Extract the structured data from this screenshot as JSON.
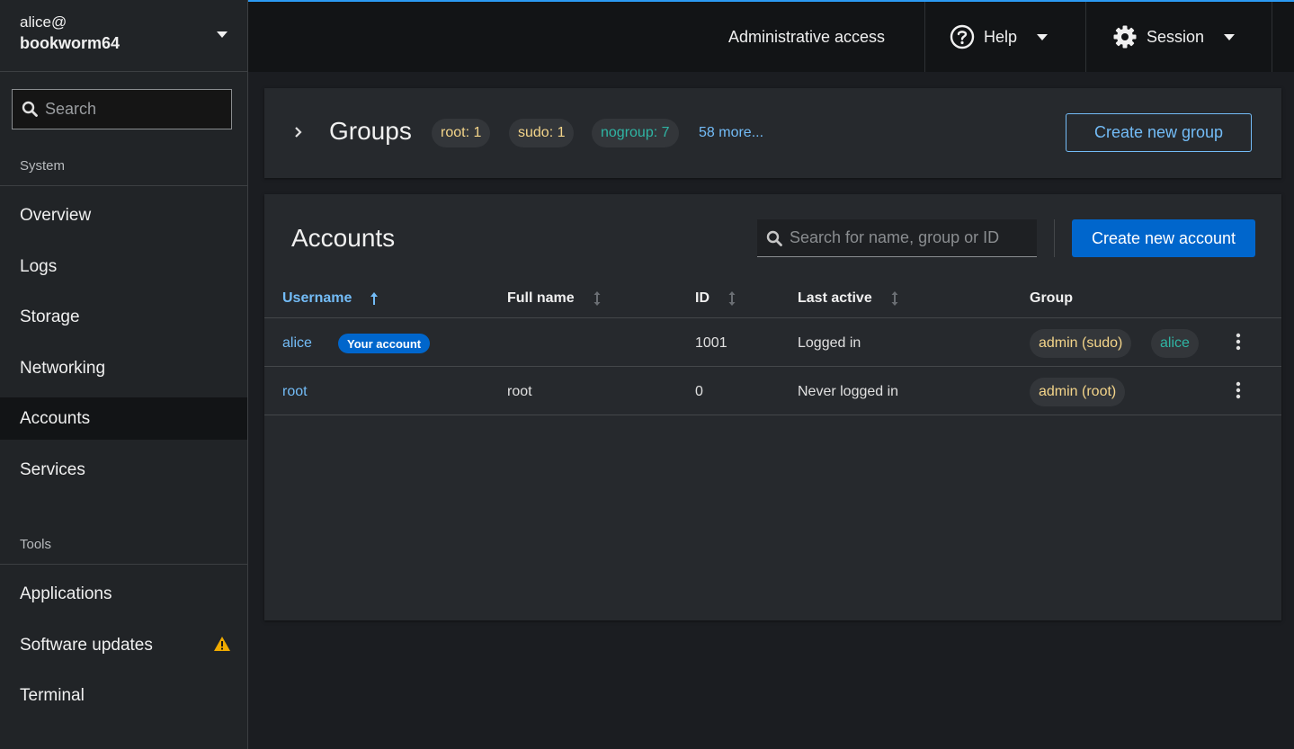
{
  "sidebar": {
    "user": "alice@",
    "host": "bookworm64",
    "search_placeholder": "Search",
    "section_system": "System",
    "system_items": [
      "Overview",
      "Logs",
      "Storage",
      "Networking",
      "Accounts",
      "Services"
    ],
    "active_item": "Accounts",
    "section_tools": "Tools",
    "tools_items": [
      "Applications",
      "Software updates",
      "Terminal"
    ],
    "warning_color": "#f0ab00"
  },
  "topbar": {
    "admin_label": "Administrative access",
    "help_label": "Help",
    "session_label": "Session",
    "accent_color": "#2b9af3"
  },
  "groups": {
    "title": "Groups",
    "chips": [
      {
        "label": "root: 1"
      },
      {
        "label": "sudo: 1"
      },
      {
        "label": "nogroup: 7"
      }
    ],
    "more_link": "58 more...",
    "create_button": "Create new group"
  },
  "accounts": {
    "title": "Accounts",
    "search_placeholder": "Search for name, group or ID",
    "create_button": "Create new account",
    "columns": {
      "username": "Username",
      "full_name": "Full name",
      "id": "ID",
      "last_active": "Last active",
      "group": "Group"
    },
    "rows": [
      {
        "username": "alice",
        "badge": "Your account",
        "full_name": "",
        "id": "1001",
        "last_active": "Logged in",
        "groups": [
          "admin (sudo)",
          "alice"
        ]
      },
      {
        "username": "root",
        "badge": "",
        "full_name": "root",
        "id": "0",
        "last_active": "Never logged in",
        "groups": [
          "admin (root)"
        ]
      }
    ]
  }
}
